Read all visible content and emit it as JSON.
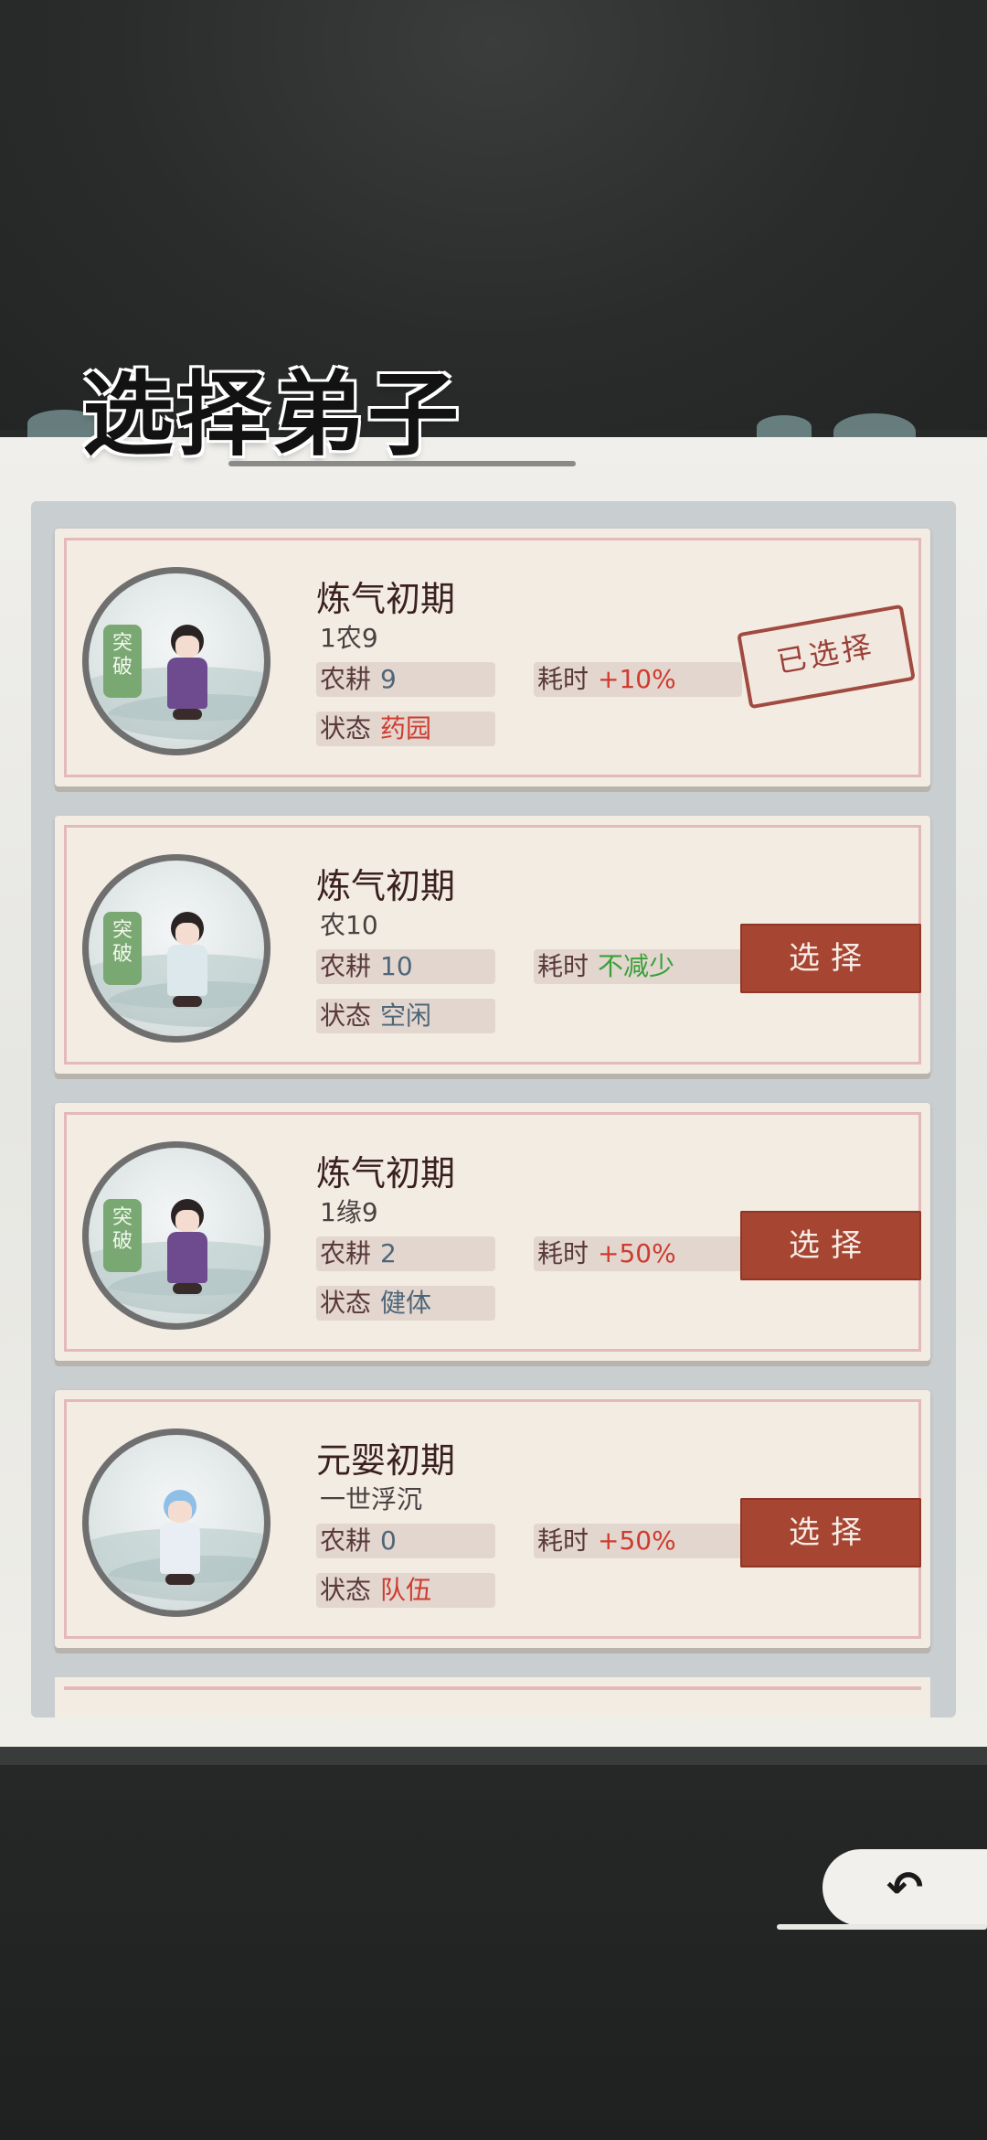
{
  "title": "选择弟子",
  "disciples": [
    {
      "realm": "炼气初期",
      "name": "1农9",
      "badge": "突破",
      "farm_label": "农耕",
      "farm_value": "9",
      "time_label": "耗时",
      "time_value": "+10%",
      "state_label": "状态",
      "state_value": "药园",
      "selected": true,
      "selected_label": "已选择",
      "char": "purple"
    },
    {
      "realm": "炼气初期",
      "name": "农10",
      "badge": "突破",
      "farm_label": "农耕",
      "farm_value": "10",
      "time_label": "耗时",
      "time_value": "不减少",
      "state_label": "状态",
      "state_value": "空闲",
      "button_label": "选择",
      "char": "white"
    },
    {
      "realm": "炼气初期",
      "name": "1缘9",
      "badge": "突破",
      "farm_label": "农耕",
      "farm_value": "2",
      "time_label": "耗时",
      "time_value": "+50%",
      "state_label": "状态",
      "state_value": "健体",
      "button_label": "选择",
      "char": "purple"
    },
    {
      "realm": "元婴初期",
      "name": "一世浮沉",
      "farm_label": "农耕",
      "farm_value": "0",
      "time_label": "耗时",
      "time_value": "+50%",
      "state_label": "状态",
      "state_value": "队伍",
      "button_label": "选择",
      "char": "blue"
    }
  ],
  "back_button": {
    "icon": "back-arrow-icon"
  },
  "colors": {
    "select_button": "#a64532",
    "card_bg": "#f3ece3",
    "time_positive": "#cf3b2e",
    "time_neutral": "#3aa03a"
  }
}
